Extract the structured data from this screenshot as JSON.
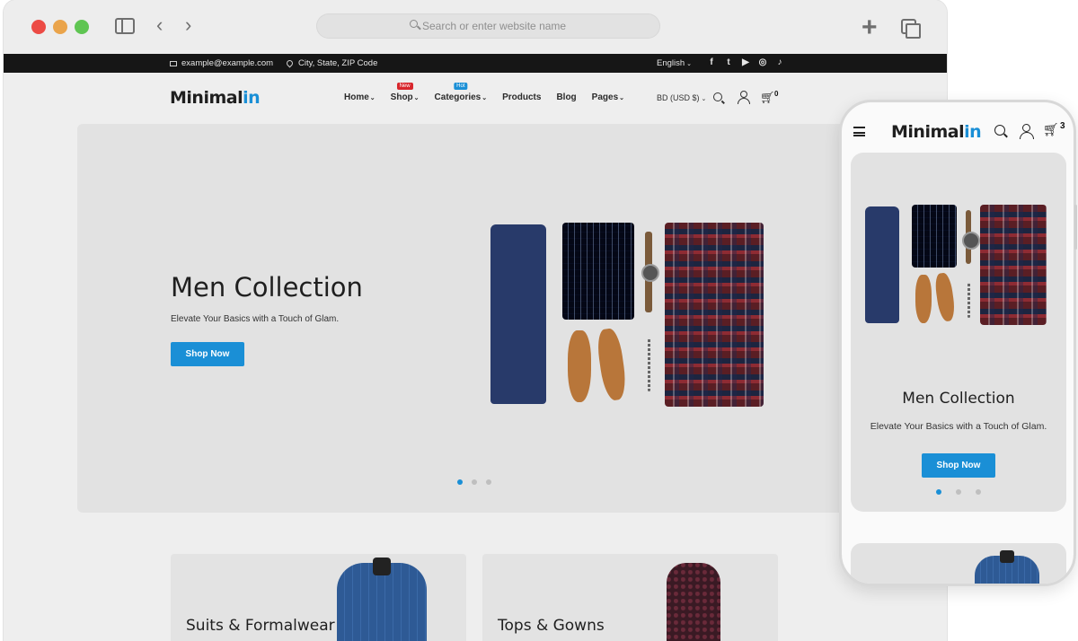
{
  "browser": {
    "address_placeholder": "Search or enter website name",
    "icons": [
      "close-dot",
      "minimize-dot",
      "maximize-dot",
      "sidebar-icon",
      "back-icon",
      "forward-icon",
      "search-icon",
      "new-tab-icon",
      "tabs-icon"
    ]
  },
  "topbar": {
    "email": "example@example.com",
    "location": "City, State, ZIP Code",
    "language": "English",
    "social": [
      "f",
      "t",
      "▶",
      "◎",
      "♪"
    ]
  },
  "header": {
    "logo_main": "Minimal",
    "logo_accent": "in",
    "menu": [
      {
        "label": "Home",
        "badge": ""
      },
      {
        "label": "Shop",
        "badge": "New"
      },
      {
        "label": "Categories",
        "badge": "Hot"
      },
      {
        "label": "Products",
        "badge": ""
      },
      {
        "label": "Blog",
        "badge": ""
      },
      {
        "label": "Pages",
        "badge": ""
      }
    ],
    "currency": "BD (USD $)",
    "cart_count": "0"
  },
  "hero": {
    "title": "Men Collection",
    "subtitle": "Elevate Your Basics with a Touch of Glam.",
    "button": "Shop Now",
    "slides": 3,
    "active_slide": 1
  },
  "categories": [
    {
      "label": "Suits & Formalwear"
    },
    {
      "label": "Tops & Gowns"
    }
  ],
  "mobile": {
    "logo_main": "Minimal",
    "logo_accent": "in",
    "cart_count": "3",
    "hero_title": "Men Collection",
    "hero_subtitle": "Elevate Your Basics with a Touch of Glam.",
    "hero_button": "Shop Now"
  },
  "colors": {
    "accent": "#1a8fd6",
    "topbar_bg": "#161616",
    "badge_new": "#d8262c",
    "badge_hot": "#1a8fd6"
  }
}
